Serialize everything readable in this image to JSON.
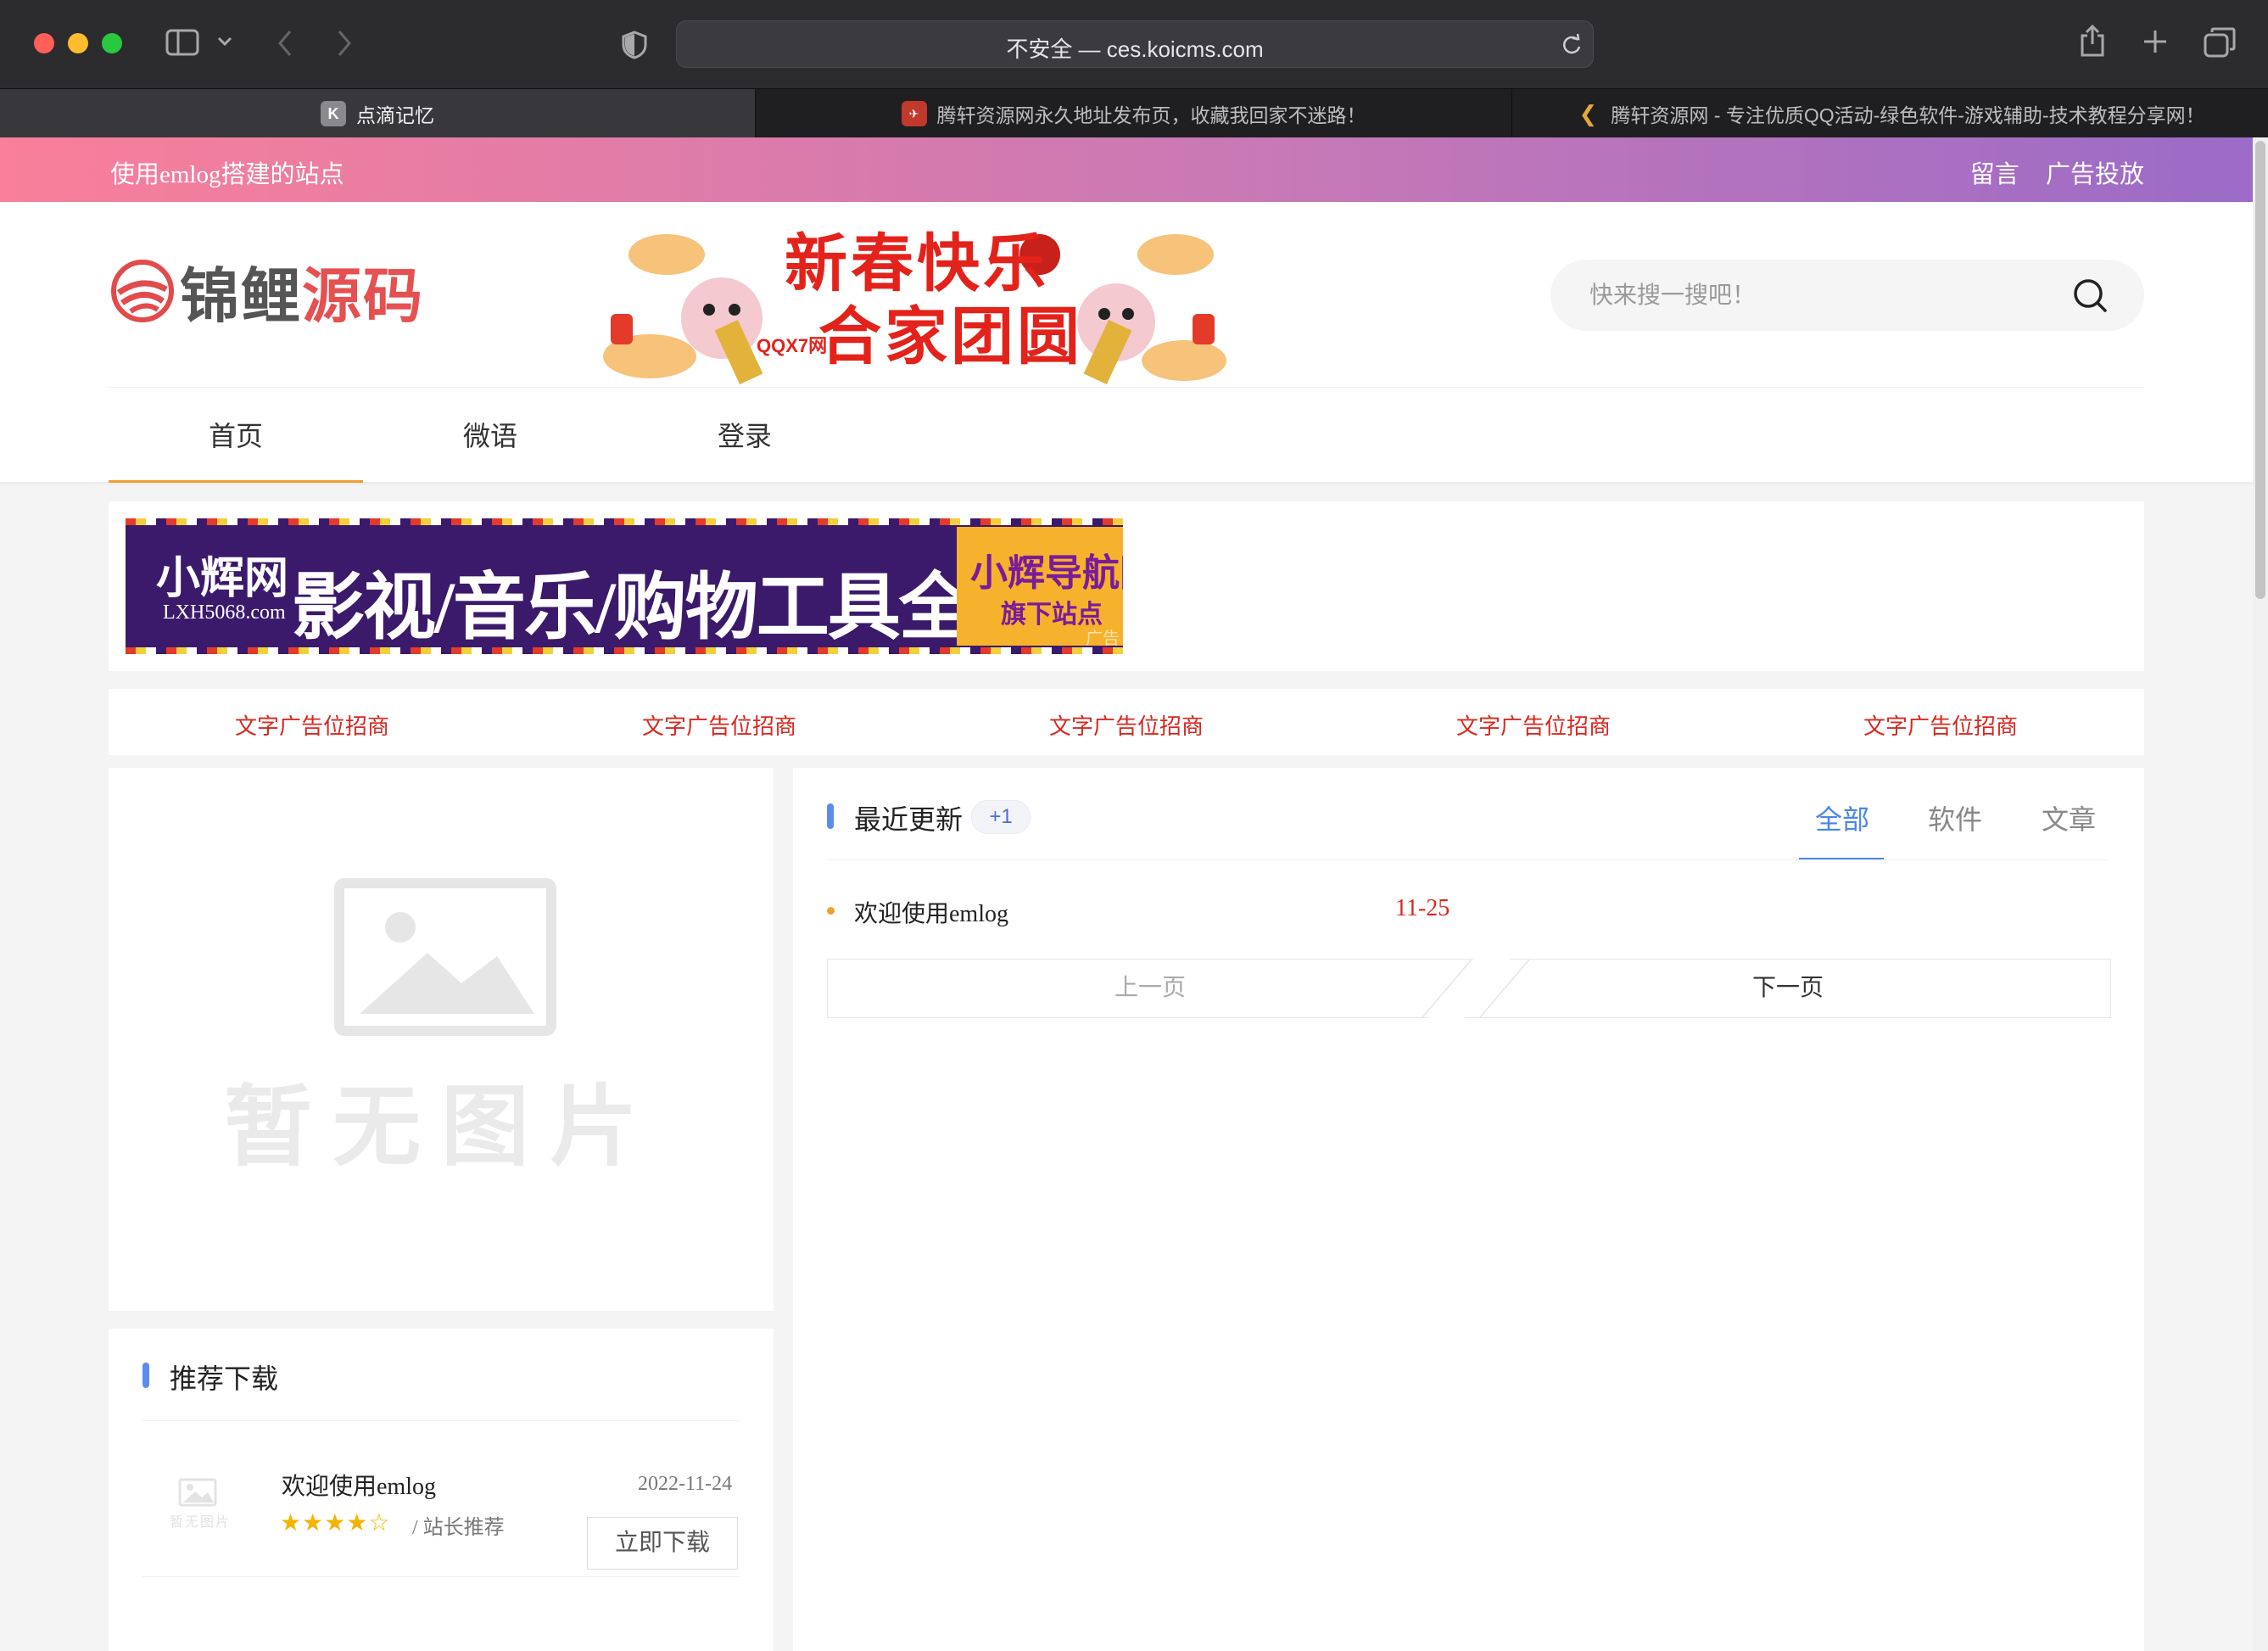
{
  "browser": {
    "url": "不安全 — ces.koicms.com",
    "tabs": [
      {
        "label": "点滴记忆",
        "favicon": "K",
        "active": true
      },
      {
        "label": "腾轩资源网永久地址发布页，收藏我回家不迷路！",
        "active": false
      },
      {
        "label": "腾轩资源网 - 专注优质QQ活动-绿色软件-游戏辅助-技术教程分享网！",
        "active": false
      }
    ]
  },
  "topbar": {
    "slogan": "使用emlog搭建的站点",
    "links": [
      "留言",
      "广告投放"
    ]
  },
  "header": {
    "logo_text_1": "锦鲤",
    "logo_text_2": "源码",
    "banner": {
      "line1": "新春快乐",
      "line2": "合家团圆",
      "badge": "QQX7网"
    },
    "search_placeholder": "快来搜一搜吧！"
  },
  "nav": {
    "items": [
      "首页",
      "微语",
      "登录"
    ],
    "active": 0
  },
  "ad": {
    "brand": "小辉网",
    "domain": "LXH5068.com",
    "headline": "影视/音乐/购物工具全免费使用",
    "right_line1": "小辉导航网",
    "right_line2": "旗下站点",
    "corner": "广告"
  },
  "text_ads": [
    "文字广告位招商",
    "文字广告位招商",
    "文字广告位招商",
    "文字广告位招商",
    "文字广告位招商"
  ],
  "placeholder": {
    "text": "暂无图片",
    "thumb_text": "暂无图片"
  },
  "recommended": {
    "title": "推荐下载",
    "items": [
      {
        "title": "欢迎使用emlog",
        "date": "2022-11-24",
        "stars": "★★★★☆",
        "tag": "/ 站长推荐",
        "button": "立即下载"
      }
    ]
  },
  "updates": {
    "title": "最近更新",
    "count": "+1",
    "tabs": [
      "全部",
      "软件",
      "文章"
    ],
    "active_tab": 0,
    "items": [
      {
        "title": "欢迎使用emlog",
        "date": "11-25"
      }
    ],
    "prev": "上一页",
    "next": "下一页"
  },
  "colors": {
    "accent_blue": "#5b8def",
    "nav_underline": "#f0a030",
    "ad_red": "#d8281f"
  }
}
